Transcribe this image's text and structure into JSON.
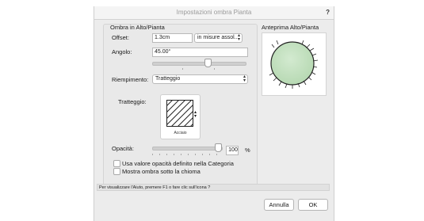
{
  "window": {
    "title": "Impostazioni ombra Pianta",
    "help_label": "?"
  },
  "group": {
    "title": "Ombra in Alto/Pianta"
  },
  "offset": {
    "label": "Offset:",
    "value": "1.3cm",
    "unit_select": "in misure assol..."
  },
  "angle": {
    "label": "Angolo:",
    "value": "45.00°",
    "slider_fraction": 0.6
  },
  "fill": {
    "label": "Riempimento:",
    "select": "Tratteggio"
  },
  "hatch": {
    "label": "Tratteggio:",
    "pattern_name": "Acciaio"
  },
  "opacity": {
    "label": "Opacità:",
    "value": "100",
    "unit": "%",
    "slider_fraction": 1.0
  },
  "options": {
    "use_category_opacity": {
      "label": "Usa valore opacità definito nella Categoria",
      "checked": false
    },
    "show_shadow_under_canopy": {
      "label": "Mostra ombra sotto la chioma",
      "checked": false
    }
  },
  "preview": {
    "title": "Anteprima Alto/Pianta"
  },
  "status": {
    "text": "Per visualizzare l'Aiuto, premere F1 o fare clic sull'icona ?"
  },
  "buttons": {
    "cancel": "Annulla",
    "ok": "OK"
  },
  "colors": {
    "canopy_fill": "#b7d9b3",
    "canopy_stroke": "#222222"
  }
}
